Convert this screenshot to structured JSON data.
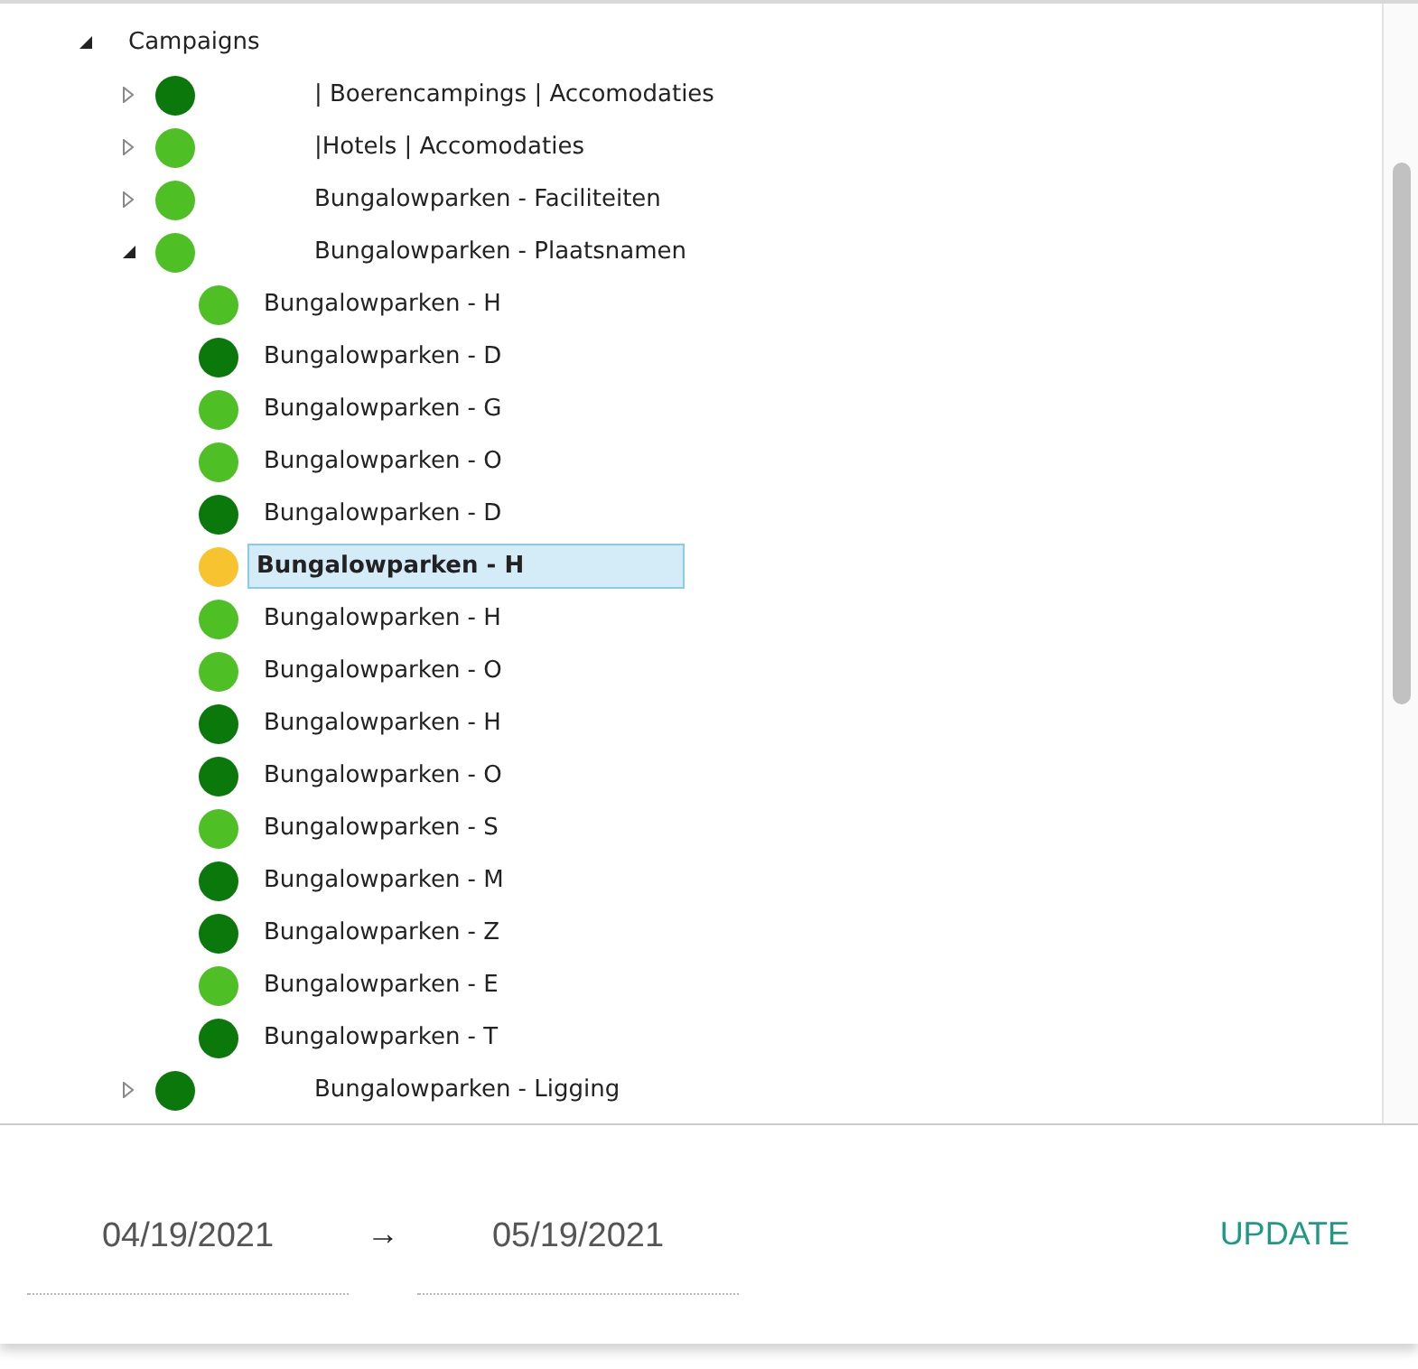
{
  "tree": [
    {
      "label": "Campaigns",
      "expanded": true,
      "selected": false,
      "children": [
        {
          "label": "| Boerencampings | Accomodaties",
          "expanded": false,
          "selected": false,
          "color": "#0b780b"
        },
        {
          "label": "|Hotels | Accomodaties",
          "expanded": false,
          "selected": false,
          "color": "#4fbf26"
        },
        {
          "label": "Bungalowparken - Faciliteiten",
          "expanded": false,
          "selected": false,
          "color": "#4fbf26"
        },
        {
          "label": "Bungalowparken - Plaatsnamen",
          "expanded": true,
          "selected": false,
          "color": "#4fbf26",
          "children": [
            {
              "label": "Bungalowparken - H",
              "selected": false,
              "color": "#4fbf26"
            },
            {
              "label": "Bungalowparken - D",
              "selected": false,
              "color": "#0b780b"
            },
            {
              "label": "Bungalowparken - G",
              "selected": false,
              "color": "#4fbf26"
            },
            {
              "label": "Bungalowparken - O",
              "selected": false,
              "color": "#4fbf26"
            },
            {
              "label": "Bungalowparken - D",
              "selected": false,
              "color": "#0b780b"
            },
            {
              "label": "Bungalowparken - H",
              "selected": true,
              "color": "#f7c430"
            },
            {
              "label": "Bungalowparken - H",
              "selected": false,
              "color": "#4fbf26"
            },
            {
              "label": "Bungalowparken - O",
              "selected": false,
              "color": "#4fbf26"
            },
            {
              "label": "Bungalowparken - H",
              "selected": false,
              "color": "#0b780b"
            },
            {
              "label": "Bungalowparken - O",
              "selected": false,
              "color": "#0b780b"
            },
            {
              "label": "Bungalowparken - S",
              "selected": false,
              "color": "#4fbf26"
            },
            {
              "label": "Bungalowparken - M",
              "selected": false,
              "color": "#0b780b"
            },
            {
              "label": "Bungalowparken - Z",
              "selected": false,
              "color": "#0b780b"
            },
            {
              "label": "Bungalowparken - E",
              "selected": false,
              "color": "#4fbf26"
            },
            {
              "label": "Bungalowparken - T",
              "selected": false,
              "color": "#0b780b"
            }
          ]
        },
        {
          "label": "Bungalowparken - Ligging",
          "expanded": false,
          "selected": false,
          "color": "#0b780b"
        }
      ]
    }
  ],
  "date_range": {
    "start": "04/19/2021",
    "separator": "→",
    "end": "05/19/2021"
  },
  "update_button": "UPDATE"
}
